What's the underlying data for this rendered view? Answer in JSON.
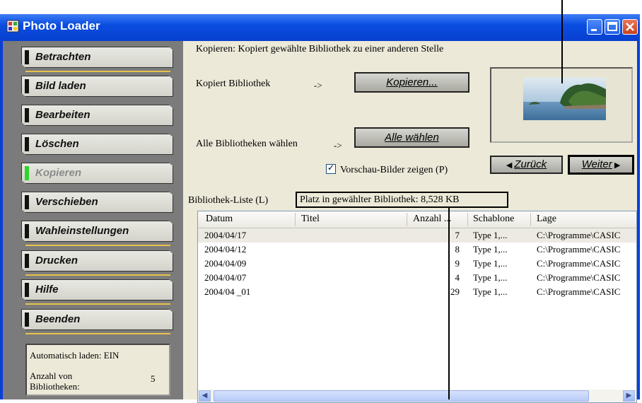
{
  "window": {
    "title": "Photo Loader"
  },
  "sidebar": {
    "items": [
      {
        "label": "Betrachten"
      },
      {
        "label": "Bild laden"
      },
      {
        "label": "Bearbeiten"
      },
      {
        "label": "Löschen"
      },
      {
        "label": "Kopieren"
      },
      {
        "label": "Verschieben"
      },
      {
        "label": "Wahleinstellungen"
      },
      {
        "label": "Drucken"
      },
      {
        "label": "Hilfe"
      },
      {
        "label": "Beenden"
      }
    ],
    "status": {
      "auto_load": "Automatisch laden: EIN",
      "count_label": "Anzahl von Bibliotheken:",
      "count_value": "5"
    }
  },
  "main": {
    "description": "Kopieren: Kopiert gewählte Bibliothek zu einer anderen Stelle",
    "copy_label": "Kopiert Bibliothek",
    "arrow": "->",
    "copy_button": "Kopieren...",
    "select_all_label": "Alle Bibliotheken wählen",
    "select_all_button": "Alle wählen",
    "preview_checkbox": "Vorschau-Bilder zeigen (P)",
    "back_button": "Zurück",
    "next_button": "Weiter",
    "list_label": "Bibliothek-Liste (L)",
    "space_text": "Platz in gewählter Bibliothek:  8,528 KB"
  },
  "table": {
    "headers": [
      "Datum",
      "Titel",
      "Anzahl ...",
      "Schablone",
      "Lage"
    ],
    "rows": [
      {
        "date": "2004/04/17",
        "title": "",
        "count": "7",
        "template": "Type 1,...",
        "location": "C:\\Programme\\CASIC"
      },
      {
        "date": "2004/04/12",
        "title": "",
        "count": "8",
        "template": "Type 1,...",
        "location": "C:\\Programme\\CASIC"
      },
      {
        "date": "2004/04/09",
        "title": "",
        "count": "9",
        "template": "Type 1,...",
        "location": "C:\\Programme\\CASIC"
      },
      {
        "date": "2004/04/07",
        "title": "",
        "count": "4",
        "template": "Type 1,...",
        "location": "C:\\Programme\\CASIC"
      },
      {
        "date": "2004/04 _01",
        "title": "",
        "count": "29",
        "template": "Type 1,...",
        "location": "C:\\Programme\\CASIC"
      }
    ]
  },
  "colors": {
    "title_bar": "#0a4de0",
    "sidebar_bg": "#7b7b7b",
    "separator": "#e8c24a",
    "disabled_mark": "#2bd52b"
  }
}
